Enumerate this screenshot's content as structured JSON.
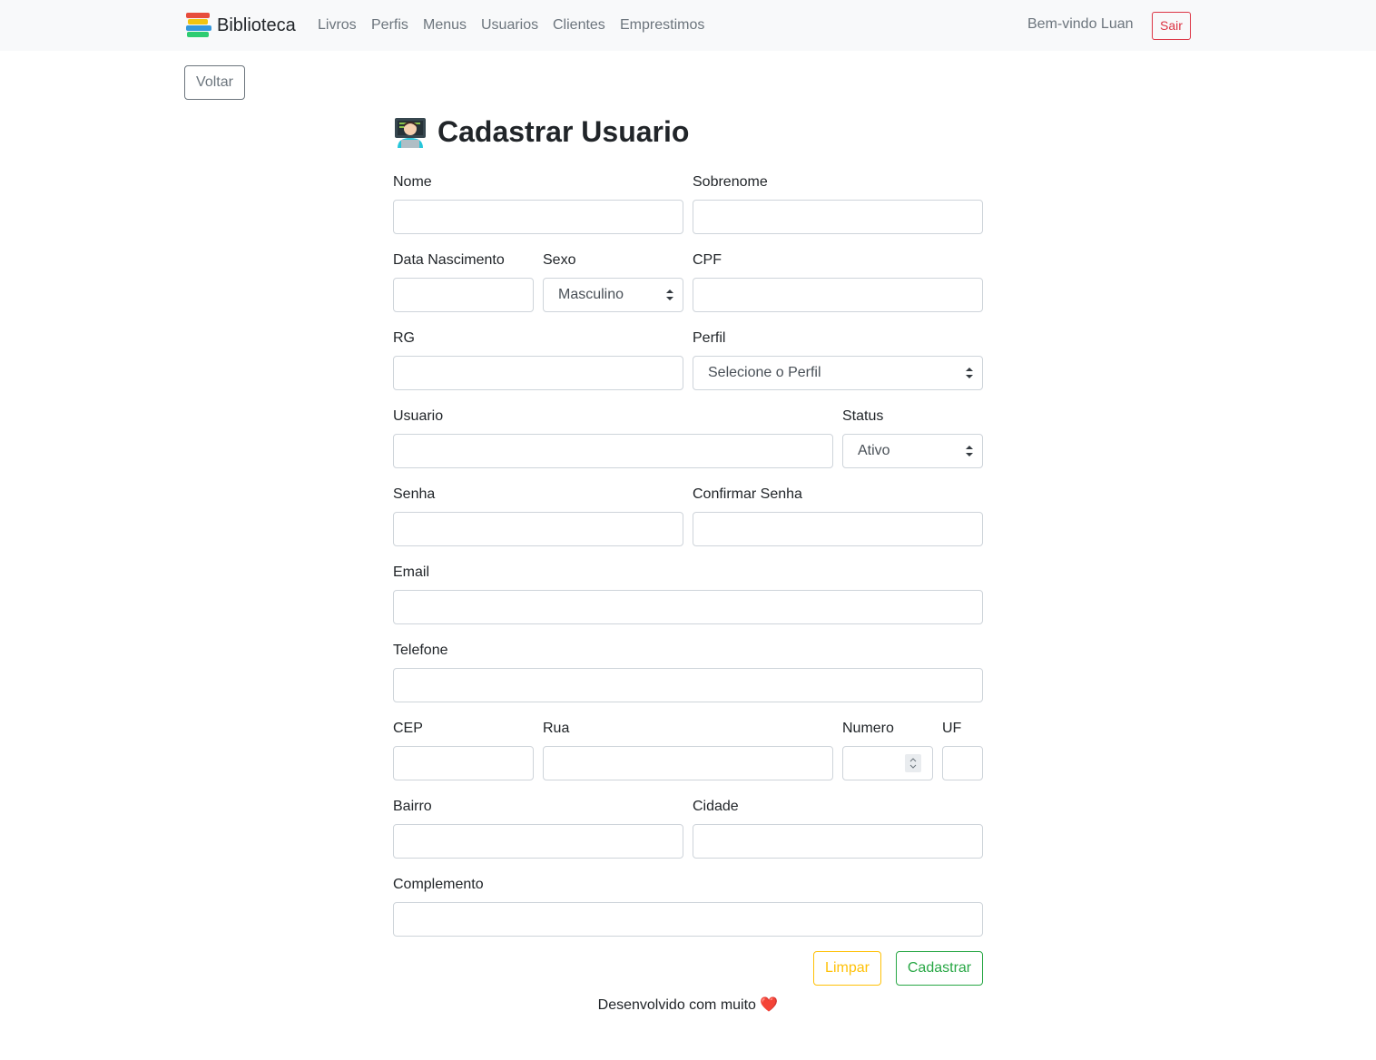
{
  "navbar": {
    "brand": "Biblioteca",
    "links": [
      "Livros",
      "Perfis",
      "Menus",
      "Usuarios",
      "Clientes",
      "Emprestimos"
    ],
    "welcome": "Bem-vindo Luan",
    "logout_label": "Sair",
    "brand_icon": "books-icon"
  },
  "back_label": "Voltar",
  "form": {
    "title": "Cadastrar Usuario",
    "title_icon": "technologist-icon",
    "labels": {
      "nome": "Nome",
      "sobrenome": "Sobrenome",
      "data_nascimento": "Data Nascimento",
      "sexo": "Sexo",
      "cpf": "CPF",
      "rg": "RG",
      "perfil": "Perfil",
      "usuario": "Usuario",
      "status": "Status",
      "senha": "Senha",
      "confirmar_senha": "Confirmar Senha",
      "email": "Email",
      "telefone": "Telefone",
      "cep": "CEP",
      "rua": "Rua",
      "numero": "Numero",
      "uf": "UF",
      "bairro": "Bairro",
      "cidade": "Cidade",
      "complemento": "Complemento"
    },
    "selects": {
      "sexo": "Masculino",
      "perfil": "Selecione o Perfil",
      "status": "Ativo"
    },
    "buttons": {
      "clear": "Limpar",
      "submit": "Cadastrar"
    }
  },
  "footer": {
    "text": "Desenvolvido com muito",
    "heart": "❤️"
  },
  "colors": {
    "navbar_bg": "#f8f9fa",
    "danger": "#dc3545",
    "warning": "#ffc107",
    "success": "#28a745",
    "secondary": "#6c757d"
  }
}
